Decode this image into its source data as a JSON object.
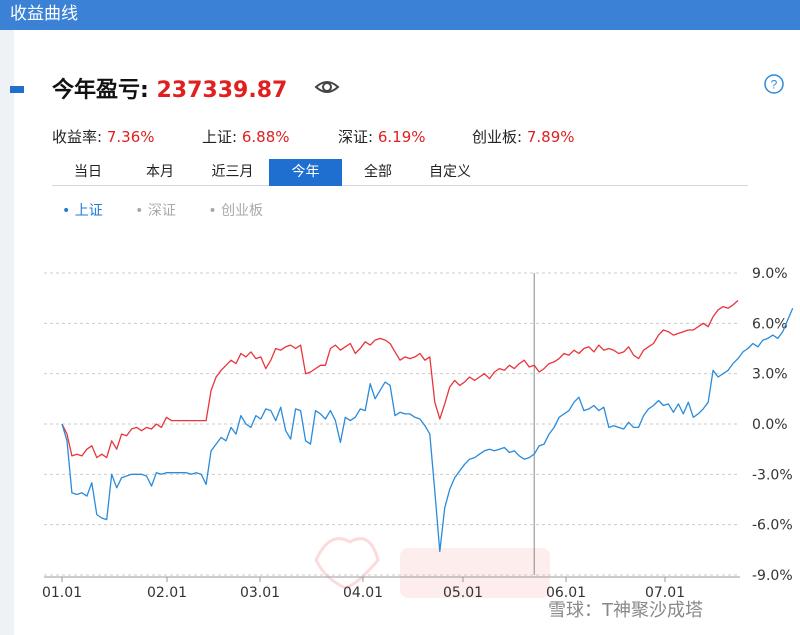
{
  "window": {
    "title": "收益曲线"
  },
  "header": {
    "label": "今年盈亏:",
    "value": "237339.87",
    "eye_icon": "eye-icon",
    "help_icon": "question-circle-icon"
  },
  "stats": [
    {
      "label": "收益率:",
      "value": "7.36%"
    },
    {
      "label": "上证:",
      "value": "6.88%"
    },
    {
      "label": "深证:",
      "value": "6.19%"
    },
    {
      "label": "创业板:",
      "value": "7.89%"
    }
  ],
  "tabs": [
    "当日",
    "本月",
    "近三月",
    "今年",
    "全部",
    "自定义"
  ],
  "active_tab": "今年",
  "legend": [
    {
      "label": "上证",
      "active": true
    },
    {
      "label": "深证",
      "active": false
    },
    {
      "label": "创业板",
      "active": false
    }
  ],
  "watermark": "雪球：T神聚沙成塔",
  "colors": {
    "accent": "#1f6fd0",
    "gain": "#e02020",
    "titlebar": "#3b82d6"
  },
  "chart_data": {
    "type": "line",
    "xlabel": "",
    "ylabel": "",
    "x_tick_labels": [
      "01.01",
      "02.01",
      "03.01",
      "04.01",
      "05.01",
      "06.01",
      "07.01"
    ],
    "y_tick_labels": [
      "9.0%",
      "6.0%",
      "3.0%",
      "0.0%",
      "-3.0%",
      "-6.0%",
      "-9.0%"
    ],
    "ylim": [
      -9,
      9
    ],
    "x_unit": "trading day index",
    "grid": true,
    "crosshair_at_index": 95,
    "series": [
      {
        "name": "收益率",
        "color": "#e8353b",
        "values": [
          0.0,
          -0.6,
          -1.9,
          -1.8,
          -1.9,
          -1.5,
          -1.3,
          -2.0,
          -1.8,
          -2.0,
          -1.0,
          -1.5,
          -0.6,
          -0.7,
          -0.3,
          -0.2,
          -0.4,
          -0.2,
          -0.3,
          0.0,
          -0.2,
          0.4,
          0.2,
          0.2,
          0.2,
          0.2,
          0.2,
          0.2,
          0.2,
          0.2,
          2.0,
          2.8,
          3.2,
          3.5,
          3.8,
          3.6,
          4.2,
          4.0,
          4.3,
          3.9,
          4.0,
          3.3,
          3.8,
          4.5,
          4.4,
          4.6,
          4.7,
          4.5,
          4.7,
          3.0,
          3.1,
          3.3,
          3.5,
          3.5,
          4.5,
          4.7,
          4.4,
          4.6,
          4.8,
          4.2,
          4.5,
          4.9,
          4.7,
          5.0,
          5.1,
          5.0,
          4.8,
          4.3,
          3.8,
          4.0,
          3.9,
          4.0,
          4.2,
          3.8,
          4.0,
          1.3,
          0.3,
          1.2,
          2.2,
          2.6,
          2.3,
          2.5,
          2.8,
          2.6,
          2.8,
          3.0,
          2.7,
          3.1,
          3.3,
          3.2,
          3.5,
          3.3,
          3.6,
          3.8,
          3.4,
          3.5,
          3.1,
          3.3,
          3.6,
          3.7,
          3.9,
          4.2,
          4.1,
          4.4,
          4.2,
          4.5,
          4.6,
          4.3,
          4.7,
          4.4,
          4.5,
          4.4,
          4.2,
          4.3,
          4.6,
          4.1,
          3.9,
          4.4,
          4.6,
          4.8,
          5.3,
          5.6,
          5.5,
          5.3,
          5.4,
          5.5,
          5.6,
          5.6,
          5.8,
          6.0,
          5.8,
          6.4,
          6.8,
          7.0,
          6.9,
          7.1,
          7.36
        ]
      },
      {
        "name": "上证",
        "color": "#2a8bdb",
        "values": [
          0.0,
          -1.0,
          -4.1,
          -4.2,
          -4.1,
          -4.3,
          -3.5,
          -5.4,
          -5.6,
          -5.7,
          -3.0,
          -3.8,
          -3.2,
          -3.1,
          -3.0,
          -3.0,
          -3.0,
          -3.1,
          -3.7,
          -2.9,
          -3.0,
          -2.9,
          -2.9,
          -2.9,
          -2.9,
          -2.9,
          -3.0,
          -2.9,
          -3.0,
          -3.6,
          -1.6,
          -1.2,
          -0.8,
          -1.0,
          -0.2,
          -0.6,
          0.5,
          0.0,
          -0.2,
          0.5,
          0.3,
          0.9,
          0.8,
          0.2,
          1.0,
          -0.4,
          -0.9,
          0.9,
          0.8,
          -1.0,
          -1.2,
          0.8,
          0.6,
          0.3,
          0.8,
          0.2,
          -1.1,
          0.4,
          0.2,
          0.4,
          0.9,
          0.8,
          2.4,
          1.5,
          2.0,
          2.5,
          2.3,
          0.5,
          0.7,
          0.6,
          0.6,
          0.4,
          0.3,
          -0.1,
          -0.6,
          -4.0,
          -7.6,
          -5.0,
          -3.9,
          -3.2,
          -2.8,
          -2.4,
          -2.1,
          -2.0,
          -1.8,
          -1.6,
          -1.5,
          -1.6,
          -1.5,
          -1.4,
          -1.7,
          -1.6,
          -1.9,
          -2.1,
          -2.0,
          -1.8,
          -1.3,
          -1.2,
          -0.6,
          -0.2,
          0.4,
          0.6,
          0.8,
          1.3,
          1.6,
          0.8,
          0.9,
          1.1,
          0.8,
          1.0,
          -0.2,
          -0.1,
          -0.2,
          -0.3,
          0.1,
          -0.2,
          -0.2,
          0.5,
          0.9,
          1.1,
          1.4,
          1.1,
          1.2,
          0.7,
          1.2,
          0.6,
          1.3,
          0.4,
          0.6,
          0.9,
          1.3,
          3.2,
          2.8,
          3.0,
          3.2,
          3.6,
          3.9,
          4.3,
          4.5,
          4.8,
          4.6,
          5.0,
          5.1,
          5.3,
          5.1,
          5.5,
          6.2,
          6.9
        ]
      }
    ]
  }
}
